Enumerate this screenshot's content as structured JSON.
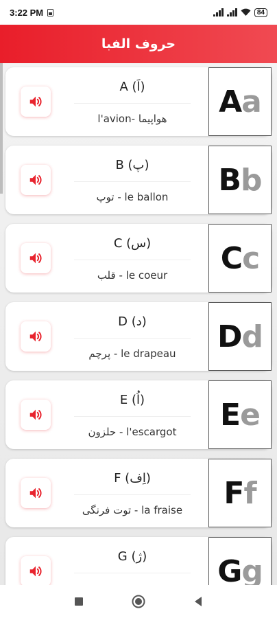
{
  "status": {
    "time": "3:22 PM",
    "battery": "84"
  },
  "app_bar": {
    "title": "حروف الفبا"
  },
  "colors": {
    "accent": "#e91e2a",
    "speaker": "#e8242e"
  },
  "items": [
    {
      "name": "A (اَ)",
      "word": "l'avion- هواپیما",
      "upper": "A",
      "lower": "a"
    },
    {
      "name": "B (پ)",
      "word": "توپ - le ballon",
      "upper": "B",
      "lower": "b"
    },
    {
      "name": "C (س)",
      "word": "قلب - le coeur",
      "upper": "C",
      "lower": "c"
    },
    {
      "name": "D (د)",
      "word": "پرچم - le drapeau",
      "upper": "D",
      "lower": "d"
    },
    {
      "name": "E (اُ)",
      "word": "حلزون - l'escargot",
      "upper": "E",
      "lower": "e"
    },
    {
      "name": "F (اِف)",
      "word": "توت فرنگی - la fraise",
      "upper": "F",
      "lower": "f"
    },
    {
      "name": "G (ژ)",
      "word": "",
      "upper": "G",
      "lower": "g"
    }
  ],
  "nav": [
    "recents-icon",
    "home-icon",
    "back-icon"
  ]
}
